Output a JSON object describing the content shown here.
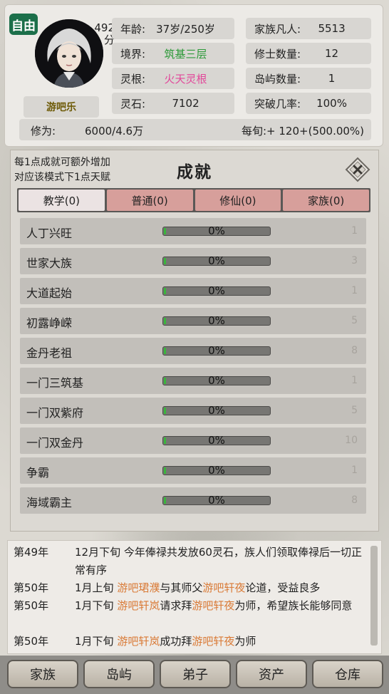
{
  "header": {
    "free_badge": "自由",
    "score": "492",
    "score_unit": "分",
    "name": "游吧乐",
    "stats": [
      {
        "label": "年龄:",
        "value": "37岁/250岁",
        "color": "#222222"
      },
      {
        "label": "境界:",
        "value": "筑基三层",
        "color": "#2e9a3a"
      },
      {
        "label": "灵根:",
        "value": "火天灵根",
        "color": "#e2489a"
      },
      {
        "label": "灵石:",
        "value": "7102",
        "color": "#222222"
      }
    ],
    "family": [
      {
        "label": "家族凡人:",
        "value": "5513"
      },
      {
        "label": "修士数量:",
        "value": "12"
      },
      {
        "label": "岛屿数量:",
        "value": "1"
      },
      {
        "label": "突破几率:",
        "value": "100%"
      }
    ],
    "cultivation_label": "修为:",
    "cultivation_value": "6000/4.6万",
    "per_turn": "每旬:+ 120+(500.00%)"
  },
  "panel": {
    "hint_line1": "每1点成就可额外增加",
    "hint_line2": "对应该模式下1点天赋",
    "title": "成就",
    "tabs": [
      "教学(0)",
      "普通(0)",
      "修仙(0)",
      "家族(0)"
    ],
    "achievements": [
      {
        "name": "人丁兴旺",
        "percent": "0%",
        "progress": 0,
        "points": "1"
      },
      {
        "name": "世家大族",
        "percent": "0%",
        "progress": 0,
        "points": "3"
      },
      {
        "name": "大道起始",
        "percent": "0%",
        "progress": 0,
        "points": "1"
      },
      {
        "name": "初露峥嵘",
        "percent": "0%",
        "progress": 0,
        "points": "5"
      },
      {
        "name": "金丹老祖",
        "percent": "0%",
        "progress": 0,
        "points": "8"
      },
      {
        "name": "一门三筑基",
        "percent": "0%",
        "progress": 0,
        "points": "1"
      },
      {
        "name": "一门双紫府",
        "percent": "0%",
        "progress": 0,
        "points": "5"
      },
      {
        "name": "一门双金丹",
        "percent": "0%",
        "progress": 0,
        "points": "10"
      },
      {
        "name": "争霸",
        "percent": "0%",
        "progress": 0,
        "points": "1"
      },
      {
        "name": "海域霸主",
        "percent": "0%",
        "progress": 0,
        "points": "8"
      }
    ]
  },
  "log": [
    {
      "year": "第49年",
      "parts": [
        {
          "t": "12月下旬 今年俸禄共发放60灵石，族人们领取俸禄后一切正常有序",
          "hl": false
        }
      ]
    },
    {
      "year": "第50年",
      "parts": [
        {
          "t": "1月上旬 ",
          "hl": false
        },
        {
          "t": "游吧珺濮",
          "hl": true
        },
        {
          "t": "与其师父",
          "hl": false
        },
        {
          "t": "游吧轩夜",
          "hl": true
        },
        {
          "t": "论道，受益良多",
          "hl": false
        }
      ]
    },
    {
      "year": "第50年",
      "parts": [
        {
          "t": "1月下旬 ",
          "hl": false
        },
        {
          "t": "游吧轩岚",
          "hl": true
        },
        {
          "t": "请求拜",
          "hl": false
        },
        {
          "t": "游吧轩夜",
          "hl": true
        },
        {
          "t": "为师，希望族长能够同意",
          "hl": false
        }
      ]
    },
    {
      "year": "第50年",
      "parts": [
        {
          "t": "1月下旬 ",
          "hl": false
        },
        {
          "t": "游吧轩岚",
          "hl": true
        },
        {
          "t": "成功拜",
          "hl": false
        },
        {
          "t": "游吧轩夜",
          "hl": true
        },
        {
          "t": "为师",
          "hl": false
        }
      ]
    }
  ],
  "nav": [
    "家族",
    "岛屿",
    "弟子",
    "资产",
    "仓库"
  ]
}
